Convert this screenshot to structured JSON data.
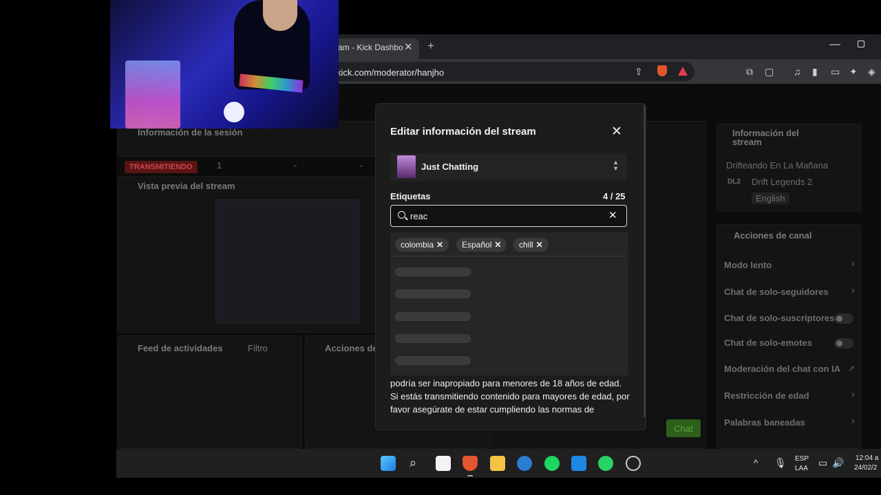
{
  "browser": {
    "tab_title": "am - Kick Dashbo",
    "tab_close": "✕",
    "new_tab": "+",
    "url": "kick.com/moderator/hanjho",
    "window_min": "—"
  },
  "dashboard": {
    "session_title": "Información de la sesión",
    "live_badge": "TRANSMITIENDO",
    "viewers": "1",
    "dash1": "-",
    "dash2": "-",
    "preview_title": "Vista previa del stream",
    "feed_title": "Feed de actividades",
    "filter_label": "Filtro",
    "actions_short": "Acciones de",
    "stream_info_title_1": "Información del",
    "stream_info_title_2": "stream",
    "stream_name": "Drifteando En La Mañana",
    "game_abbr": "DL2",
    "game_name": "Drift Legends 2",
    "language": "English",
    "channel_actions_title": "Acciones de canal",
    "actions": [
      {
        "label": "Modo lento",
        "kind": "chevron"
      },
      {
        "label": "Chat de solo-seguidores",
        "kind": "chevron"
      },
      {
        "label": "Chat de solo-suscriptores",
        "kind": "toggle"
      },
      {
        "label": "Chat de solo-emotes",
        "kind": "toggle"
      },
      {
        "label": "Moderación del chat con IA",
        "kind": "external"
      },
      {
        "label": "Restricción de edad",
        "kind": "chevron"
      },
      {
        "label": "Palabras baneadas",
        "kind": "chevron"
      }
    ],
    "chat_button": "Chat"
  },
  "modal": {
    "title": "Editar información del stream",
    "close": "✕",
    "category": "Just Chatting",
    "tags_label": "Etiquetas",
    "tags_count": "4 / 25",
    "search_value": "reac",
    "search_clear": "✕",
    "chips": [
      {
        "label": "colombia"
      },
      {
        "label": "Español"
      },
      {
        "label": "chill"
      }
    ],
    "chip_remove": "✕",
    "warning": "podría ser inapropiado para menores de 18 años de edad. Si estás transmitiendo contenido para mayores de edad, por favor asegúrate de estar cumpliendo las normas de"
  },
  "taskbar": {
    "lang_top": "ESP",
    "lang_bottom": "LAA",
    "time": "12:04 a",
    "date": "24/02/2"
  },
  "colors": {
    "accent_green": "#53fc18",
    "modal_bg": "#1c1c1c",
    "live_red": "#c94848"
  }
}
